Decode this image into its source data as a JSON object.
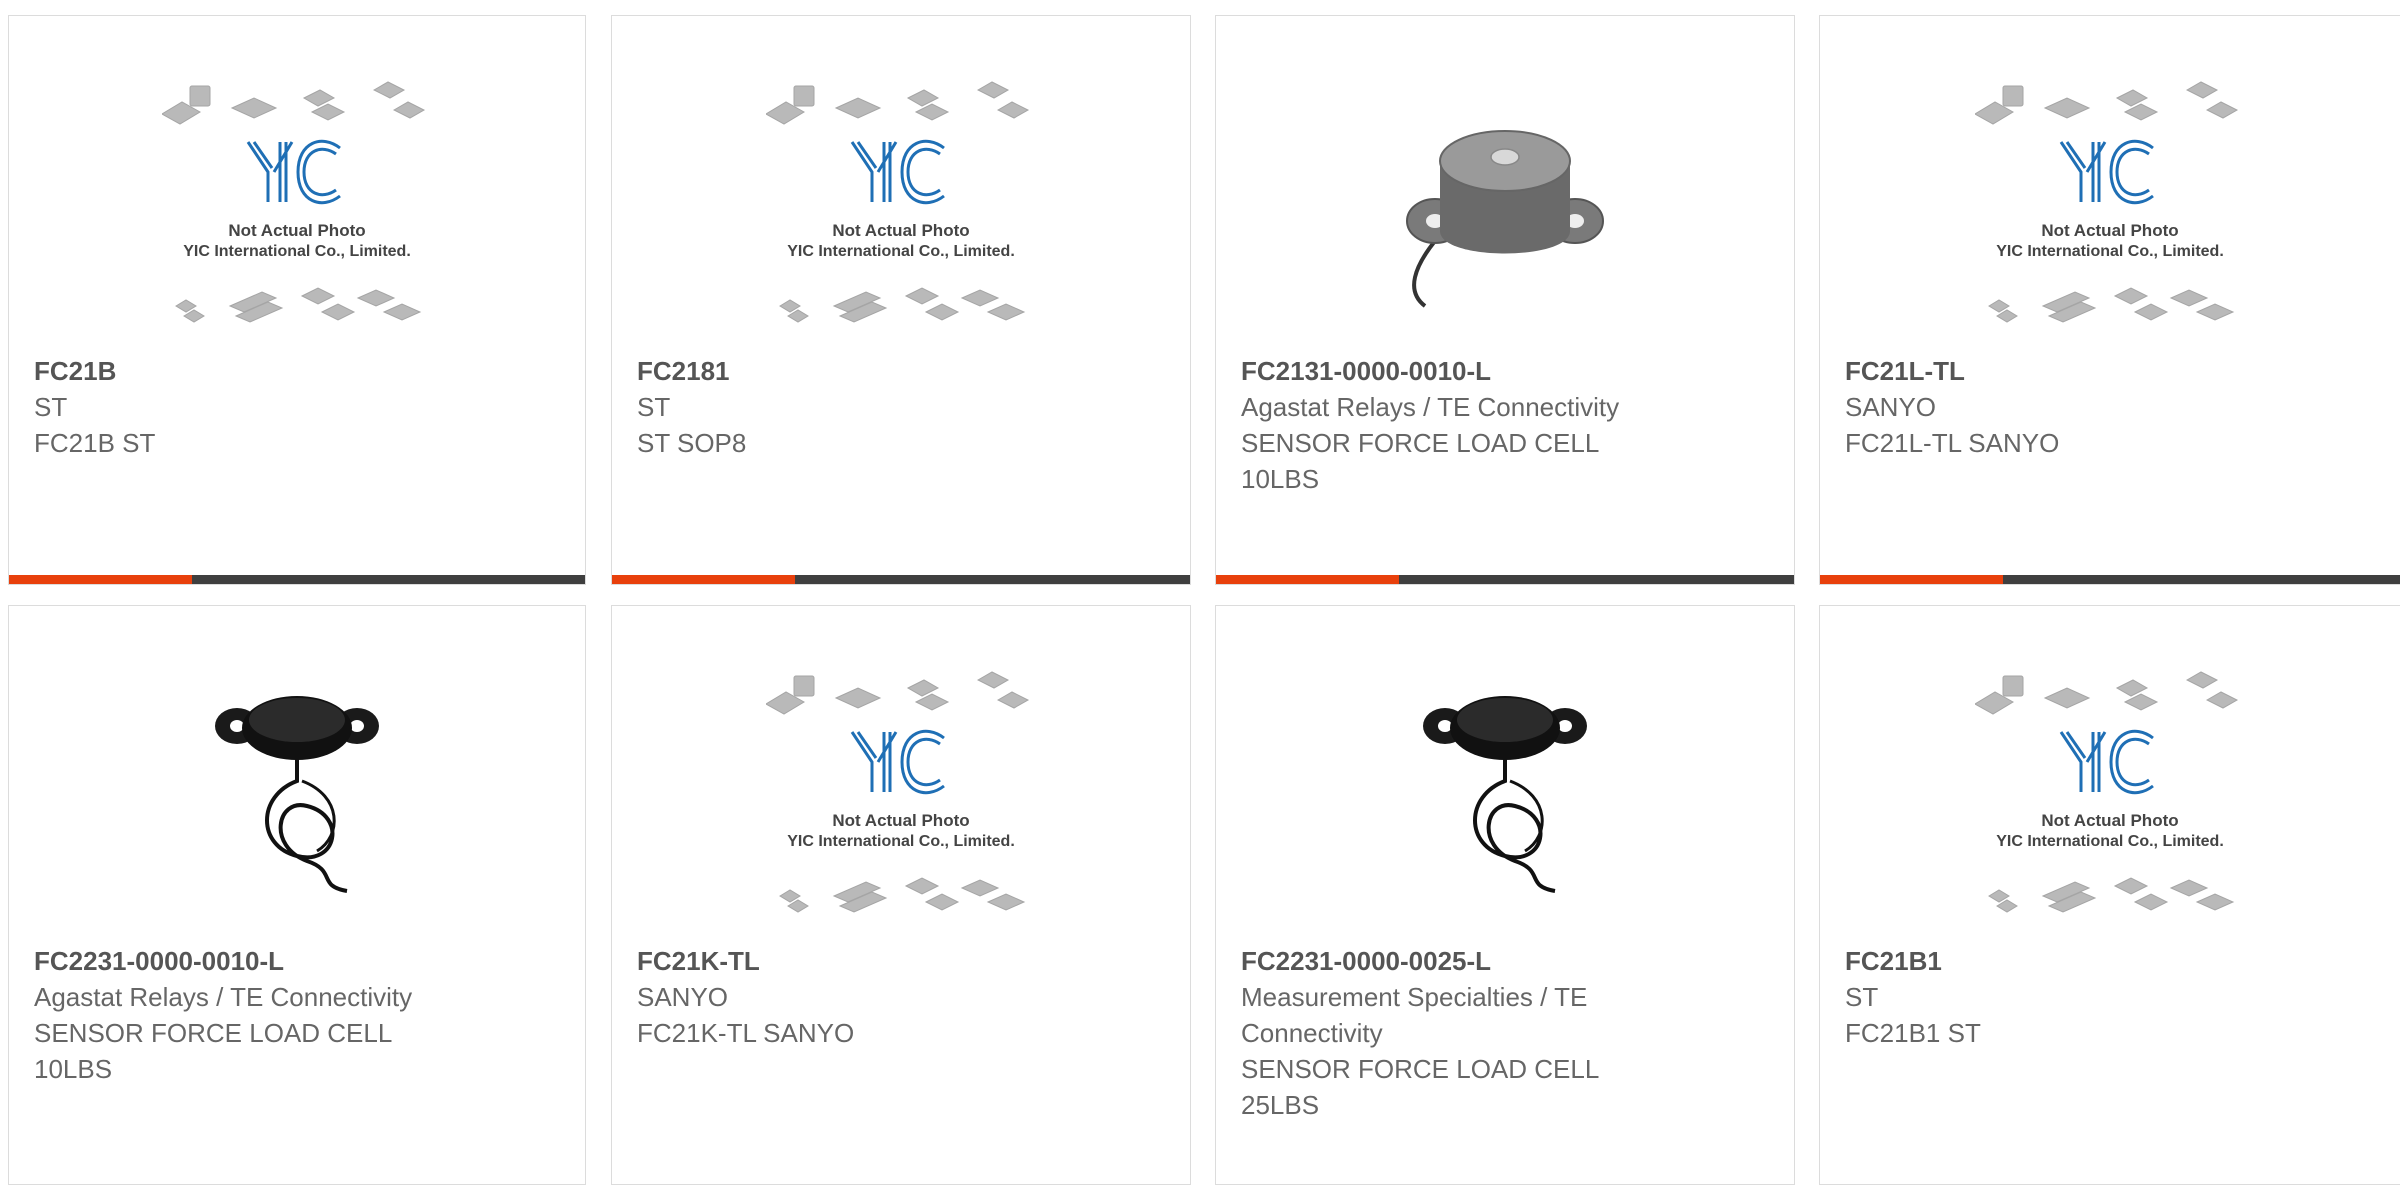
{
  "products": [
    {
      "part_number": "FC21B",
      "manufacturer": "ST",
      "description": "FC21B ST",
      "image": "placeholder-not-actual-photo"
    },
    {
      "part_number": "FC2181",
      "manufacturer": "ST",
      "description": "ST SOP8",
      "image": "placeholder-not-actual-photo"
    },
    {
      "part_number": "FC2131-0000-0010-L",
      "manufacturer": "Agastat Relays / TE Connectivity",
      "description": "SENSOR FORCE LOAD CELL 10LBS",
      "image": "load-cell-photo"
    },
    {
      "part_number": "FC21L-TL",
      "manufacturer": "SANYO",
      "description": "FC21L-TL SANYO",
      "image": "placeholder-not-actual-photo"
    },
    {
      "part_number": "FC2231-0000-0010-L",
      "manufacturer": "Agastat Relays / TE Connectivity",
      "description": "SENSOR FORCE LOAD CELL 10LBS",
      "image": "load-cell-cable-photo"
    },
    {
      "part_number": "FC21K-TL",
      "manufacturer": "SANYO",
      "description": "FC21K-TL SANYO",
      "image": "placeholder-not-actual-photo"
    },
    {
      "part_number": "FC2231-0000-0025-L",
      "manufacturer": "Measurement Specialties / TE Connectivity",
      "description": "SENSOR FORCE LOAD CELL 25LBS",
      "image": "load-cell-cable-photo"
    },
    {
      "part_number": "FC21B1",
      "manufacturer": "ST",
      "description": "FC21B1 ST",
      "image": "placeholder-not-actual-photo"
    }
  ],
  "placeholder": {
    "logo_text": "YIC",
    "caption_line1": "Not Actual Photo",
    "caption_line2": "YIC International Co., Limited."
  },
  "colors": {
    "accent": "#e8400c",
    "bar": "#3f3f3f",
    "logo": "#1f6fb5"
  }
}
